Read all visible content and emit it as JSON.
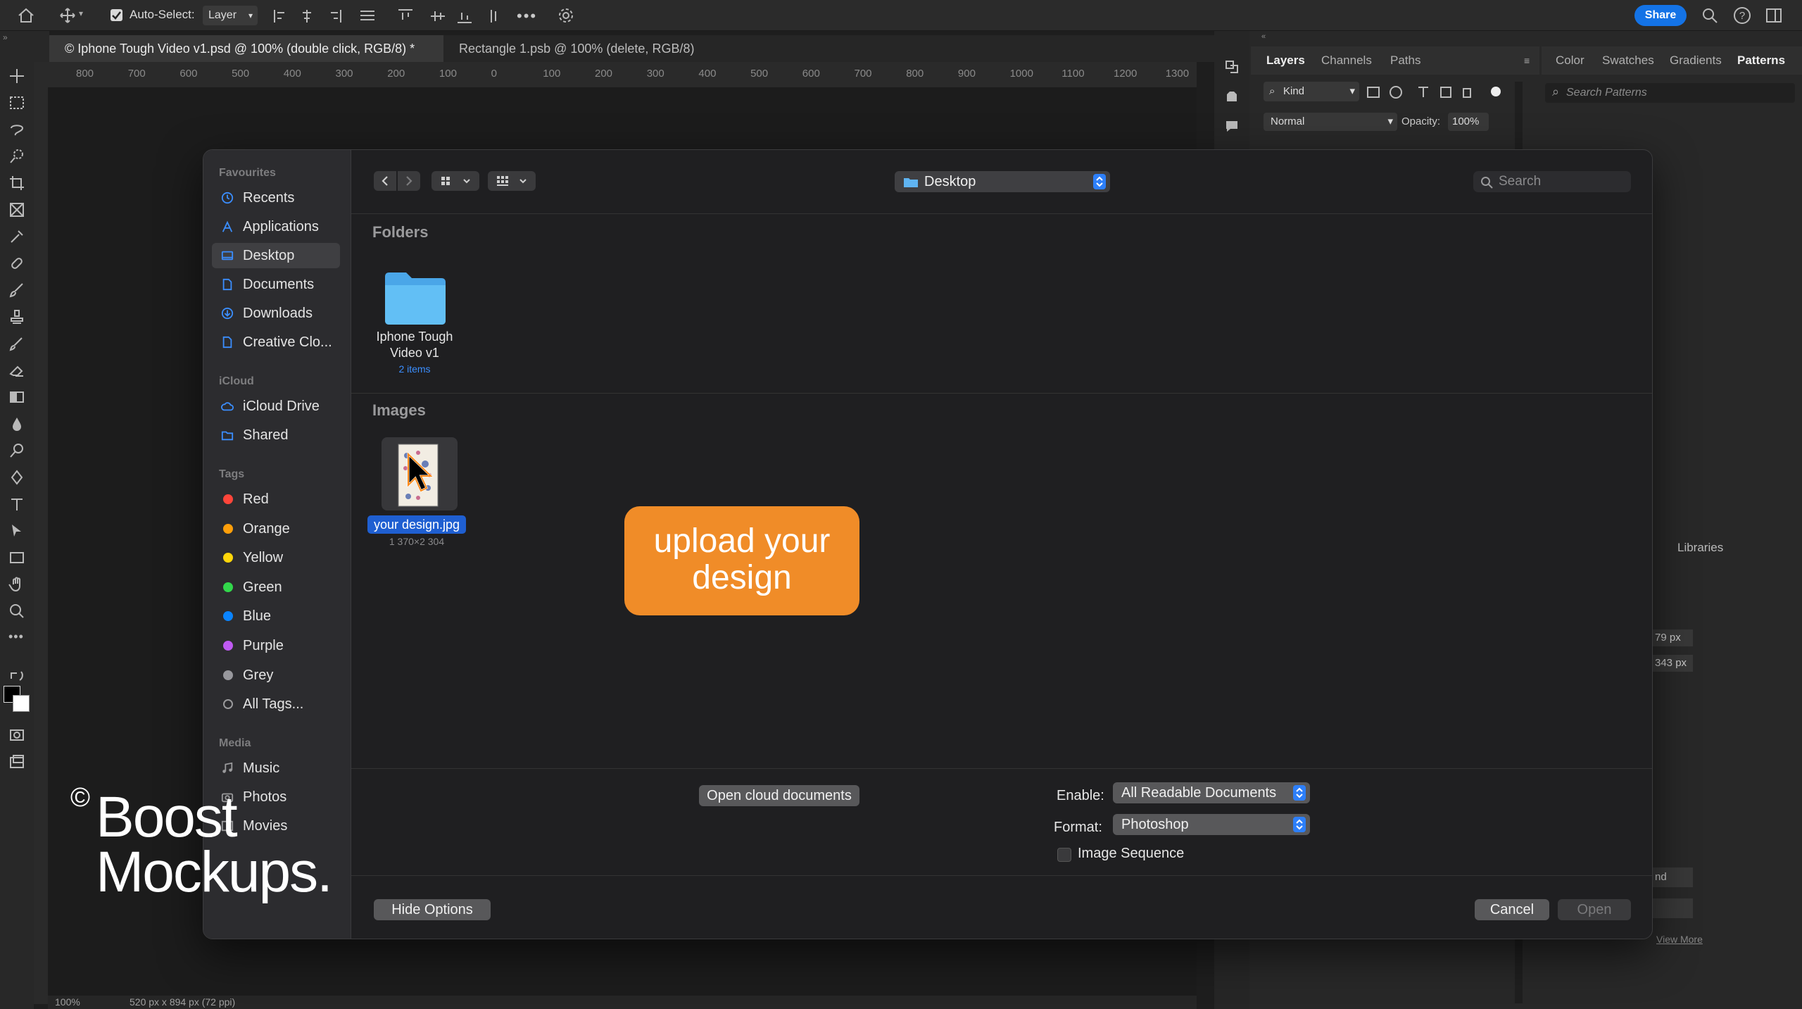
{
  "app": {
    "menubar": {
      "auto_select_label": "Auto-Select:",
      "auto_select_value": "Layer",
      "share_label": "Share"
    },
    "document_tabs": [
      {
        "label": "© Iphone Tough Video v1.psd @ 100% (double click, RGB/8) *"
      },
      {
        "label": "Rectangle 1.psb @ 100% (delete, RGB/8)"
      }
    ],
    "ruler_ticks": [
      "800",
      "700",
      "600",
      "500",
      "400",
      "300",
      "200",
      "100",
      "0",
      "100",
      "200",
      "300",
      "400",
      "500",
      "600",
      "700",
      "800",
      "900",
      "1000",
      "1100",
      "1200",
      "1300"
    ],
    "status_bar": {
      "zoom": "100%",
      "doc_info": "520 px x 894 px (72 ppi)"
    }
  },
  "right_panel": {
    "tabs_left": [
      "Layers",
      "Channels",
      "Paths"
    ],
    "tabs_right": [
      "Color",
      "Swatches",
      "Gradients",
      "Patterns"
    ],
    "kind_label": "Kind",
    "blend_mode": "Normal",
    "opacity_label": "Opacity:",
    "opacity_value": "100%",
    "search_patterns_placeholder": "Search Patterns",
    "libraries_tab": "Libraries",
    "width_value": "79 px",
    "height_value": "343 px",
    "partial_field": "nd",
    "view_more": "View More"
  },
  "dialog": {
    "location": "Desktop",
    "search_placeholder": "Search",
    "sidebar": {
      "favourites_header": "Favourites",
      "favourites": [
        "Recents",
        "Applications",
        "Desktop",
        "Documents",
        "Downloads",
        "Creative Clo..."
      ],
      "icloud_header": "iCloud",
      "icloud": [
        "iCloud Drive",
        "Shared"
      ],
      "tags_header": "Tags",
      "tags": [
        {
          "label": "Red",
          "color": "#ff453a"
        },
        {
          "label": "Orange",
          "color": "#ff9f0a"
        },
        {
          "label": "Yellow",
          "color": "#ffd60a"
        },
        {
          "label": "Green",
          "color": "#32d74b"
        },
        {
          "label": "Blue",
          "color": "#0a84ff"
        },
        {
          "label": "Purple",
          "color": "#bf5af2"
        },
        {
          "label": "Grey",
          "color": "#98989d"
        },
        {
          "label": "All Tags...",
          "color": ""
        }
      ],
      "media_header": "Media",
      "media": [
        "Music",
        "Photos",
        "Movies"
      ]
    },
    "folders_header": "Folders",
    "folder": {
      "name_line1": "Iphone Tough",
      "name_line2": "Video v1",
      "count": "2 items"
    },
    "images_header": "Images",
    "image": {
      "name": "your design.jpg",
      "dimensions": "1 370×2 304"
    },
    "callout": {
      "line1": "upload your",
      "line2": "design",
      "color": "#f08c28"
    },
    "open_cloud_label": "Open cloud documents",
    "enable_label": "Enable:",
    "enable_value": "All Readable Documents",
    "format_label": "Format:",
    "format_value": "Photoshop",
    "image_sequence_label": "Image Sequence",
    "hide_options_label": "Hide Options",
    "cancel_label": "Cancel",
    "open_label": "Open"
  },
  "watermark": {
    "line1": "Boost",
    "line2": "Mockups.",
    "copyright": "©"
  },
  "colors": {
    "accent": "#2d7ff9",
    "selection": "#1f5fd1",
    "share": "#1473e6"
  }
}
